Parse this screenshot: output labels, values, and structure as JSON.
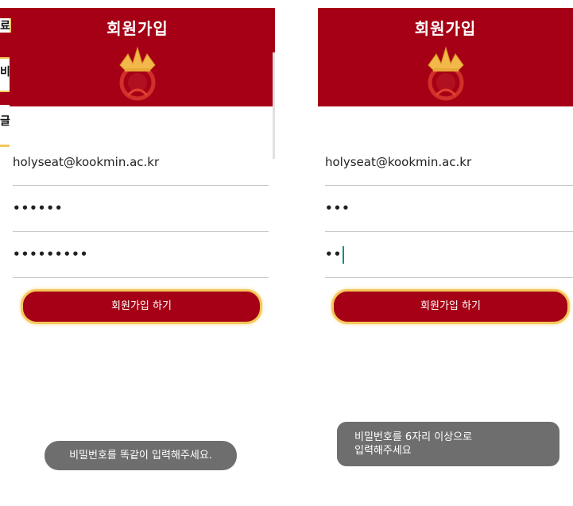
{
  "left": {
    "title": "회원가입",
    "email": "holyseat@kookmin.ac.kr",
    "password": "••••••",
    "password_confirm": "•••••••••",
    "button": "회원가입 하기",
    "toast": "비밀번호를 똑같이 입력해주세요.",
    "artifacts": [
      "료",
      "비",
      "글"
    ]
  },
  "right": {
    "title": "회원가입",
    "email": "holyseat@kookmin.ac.kr",
    "password": "•••",
    "password_confirm": "••",
    "button": "회원가입 하기",
    "toast_line1": "비밀번호를 6자리 이상으로",
    "toast_line2": "입력해주세요"
  },
  "colors": {
    "header": "#a50016",
    "button_border": "#f4c85a",
    "toast": "#6e6e6e"
  }
}
